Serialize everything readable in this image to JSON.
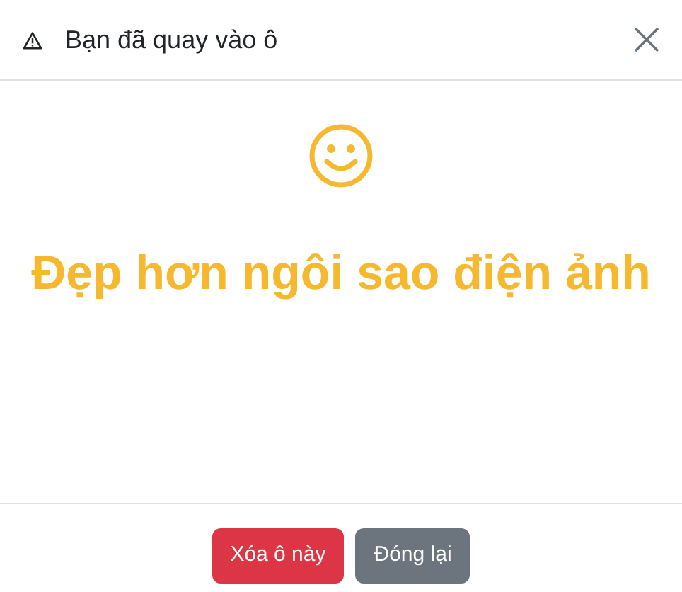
{
  "dialog": {
    "title": "Bạn đã quay vào ô",
    "result": "Đẹp hơn ngôi sao điện ảnh"
  },
  "buttons": [
    {
      "label": "Xóa ô này",
      "kind": "danger"
    },
    {
      "label": "Đóng lại",
      "kind": "secondary"
    }
  ]
}
